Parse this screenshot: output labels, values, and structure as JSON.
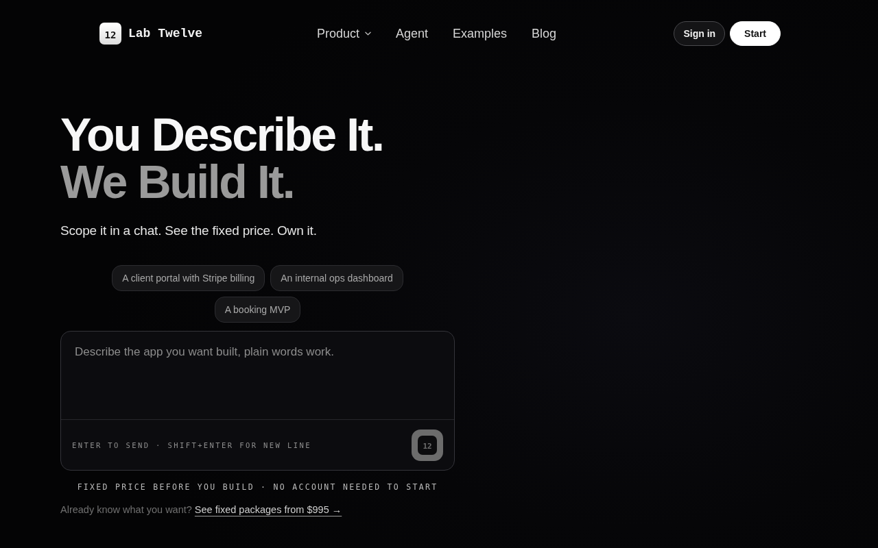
{
  "header": {
    "logo": {
      "mark": "12",
      "name": "Lab Twelve"
    },
    "nav": [
      {
        "label": "Product",
        "has_menu": true
      },
      {
        "label": "Agent",
        "has_menu": false
      },
      {
        "label": "Examples",
        "has_menu": false
      },
      {
        "label": "Blog",
        "has_menu": false
      }
    ],
    "buttons": [
      {
        "label": "Sign in",
        "kind": "outline"
      },
      {
        "label": "Start",
        "kind": "solid"
      }
    ]
  },
  "hero": {
    "title_lines": [
      {
        "text": "You Describe It.",
        "dimmed": false
      },
      {
        "text": "We Build It.",
        "dimmed": true
      }
    ],
    "subtitle": "Scope it in a chat. See the fixed price. Own it.",
    "suggestions": [
      "A client portal with Stripe billing",
      "An internal ops dashboard",
      "A booking MVP"
    ],
    "composer": {
      "placeholder": "Describe the app you want built, plain words work.",
      "hint": "ENTER TO SEND · SHIFT+ENTER FOR NEW LINE",
      "send_button": {
        "mark": "12",
        "disabled": true
      }
    },
    "note": "FIXED PRICE BEFORE YOU BUILD · NO ACCOUNT NEEDED TO START",
    "packages": {
      "text": "Already know what you want?",
      "link": "See fixed packages from $995 →"
    }
  }
}
